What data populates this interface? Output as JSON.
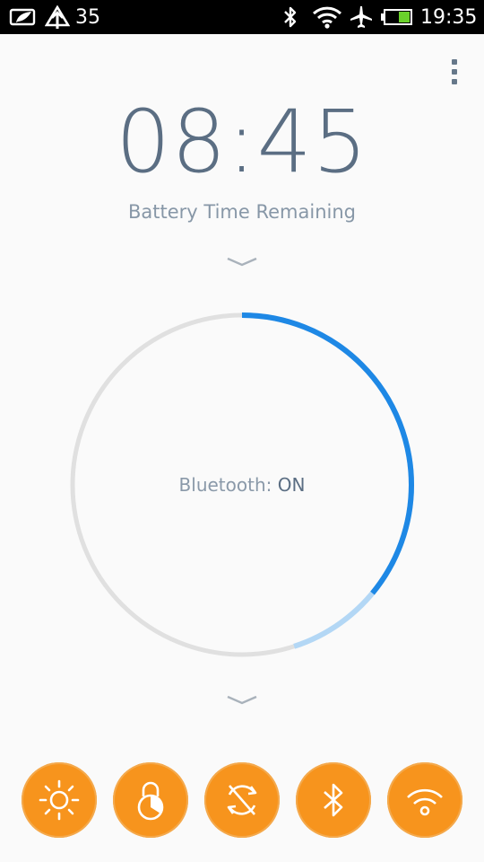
{
  "status_bar": {
    "notification_count": "35",
    "clock": "19:35",
    "icons": [
      "notification-leaf-icon",
      "upload-icon",
      "bluetooth-icon",
      "wifi-icon",
      "airplane-icon",
      "battery-icon"
    ]
  },
  "header": {
    "menu_icon": "overflow-menu-icon"
  },
  "main": {
    "time_remaining": "08:45",
    "subtitle": "Battery Time Remaining",
    "status_label": "Bluetooth: ",
    "status_value": "ON",
    "battery_level_fraction": 0.36,
    "battery_projected_fraction": 0.09
  },
  "quick_toggles": [
    {
      "name": "brightness-icon"
    },
    {
      "name": "screen-lock-icon"
    },
    {
      "name": "auto-sync-icon"
    },
    {
      "name": "bluetooth-icon"
    },
    {
      "name": "wifi-icon"
    }
  ],
  "colors": {
    "accent_orange": "#f7941d",
    "ring_blue": "#1e88e5",
    "ring_light_blue": "#b3d7f5",
    "ring_track": "#e0e0e0",
    "time_text": "#5b6e83"
  }
}
